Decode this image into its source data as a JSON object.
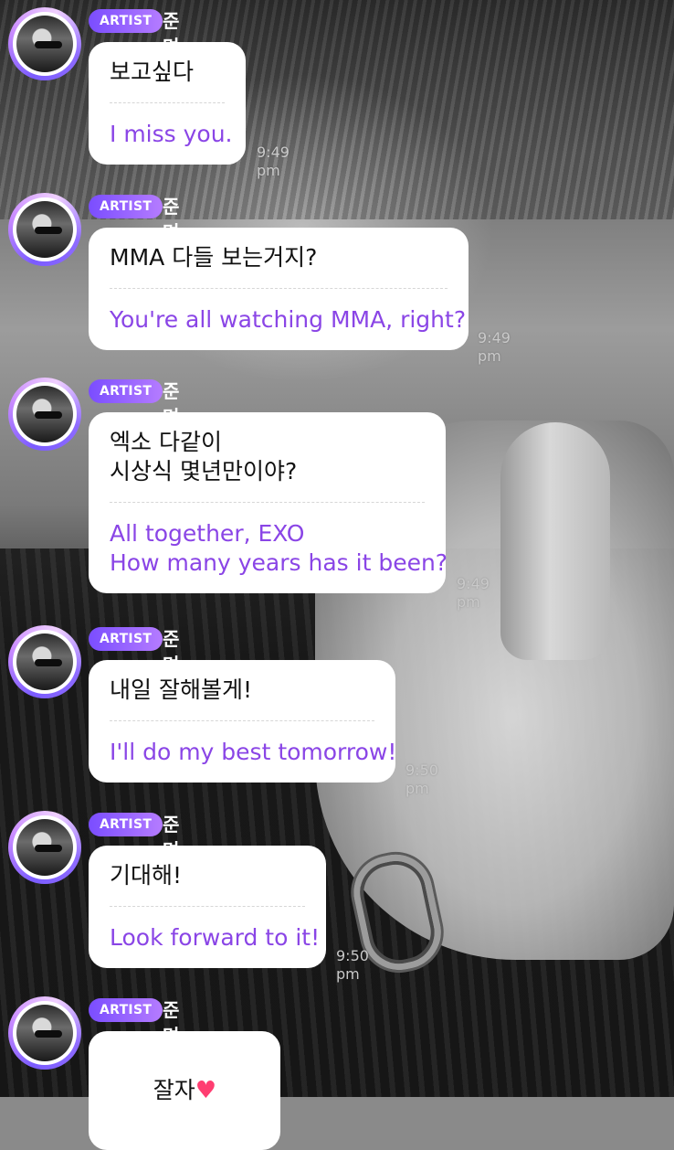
{
  "messages": [
    {
      "badge": "ARTIST",
      "name": "준며니",
      "ko": "보고싶다",
      "en": "I miss you.",
      "time": "9:49 pm"
    },
    {
      "badge": "ARTIST",
      "name": "준며니",
      "ko": "MMA 다들 보는거지?",
      "en": "You're all watching MMA, right?",
      "time": "9:49 pm"
    },
    {
      "badge": "ARTIST",
      "name": "준며니",
      "ko": "엑소 다같이\n시상식 몇년만이야?",
      "en": "All together, EXO\nHow many years has it been?",
      "time": "9:49 pm"
    },
    {
      "badge": "ARTIST",
      "name": "준며니",
      "ko": "내일 잘해볼게!",
      "en": "I'll do my best tomorrow!",
      "time": "9:50 pm"
    },
    {
      "badge": "ARTIST",
      "name": "준며니",
      "ko": "기대해!",
      "en": "Look forward to it!",
      "time": "9:50 pm"
    },
    {
      "badge": "ARTIST",
      "name": "준며니",
      "ko": "잘자",
      "heart": "♥"
    }
  ],
  "colors": {
    "badge_start": "#7a4dff",
    "badge_end": "#b57cff",
    "translation_text": "#8a45e6",
    "heart": "#ff3d71"
  },
  "icons": [
    "artist-avatar",
    "heart-emoji"
  ]
}
